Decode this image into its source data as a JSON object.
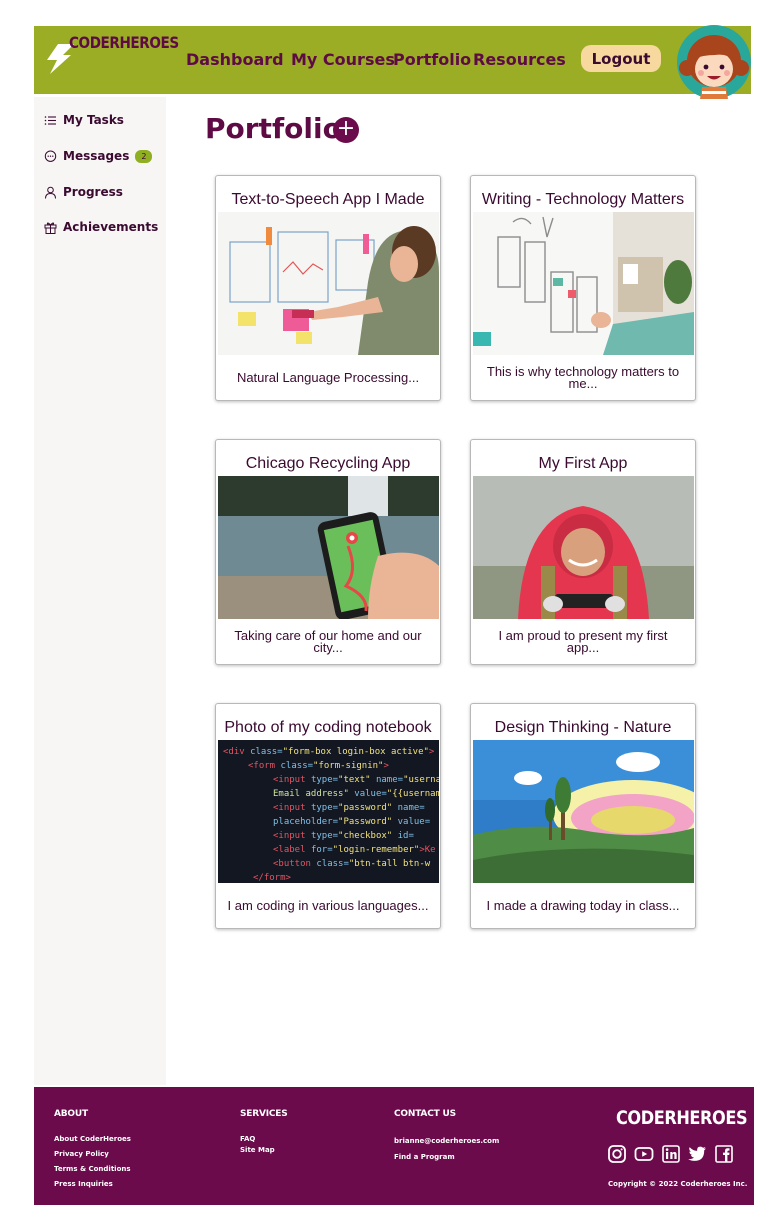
{
  "header": {
    "brand": "CODERHEROES",
    "nav": [
      "Dashboard",
      "My Courses",
      "Portfolio",
      "Resources"
    ],
    "logout_label": "Logout"
  },
  "sidebar": {
    "items": [
      {
        "label": "My Tasks",
        "icon": "list-icon"
      },
      {
        "label": "Messages",
        "icon": "chat-icon",
        "badge": "2"
      },
      {
        "label": "Progress",
        "icon": "person-icon"
      },
      {
        "label": "Achievements",
        "icon": "gift-icon"
      }
    ]
  },
  "main": {
    "title": "Portfolio",
    "add_label": "+",
    "cards": [
      {
        "title": "Text-to-Speech App I Made",
        "description": "Natural Language Processing..."
      },
      {
        "title": "Writing - Technology Matters",
        "description": "This is why technology matters to me..."
      },
      {
        "title": "Chicago Recycling App",
        "description": "Taking care of our home and our city..."
      },
      {
        "title": "My First App",
        "description": "I am proud to present my first app..."
      },
      {
        "title": "Photo of my coding notebook",
        "description": "I am coding in various languages..."
      },
      {
        "title": "Design Thinking - Nature",
        "description": "I made a drawing today in class..."
      }
    ]
  },
  "footer": {
    "about": {
      "heading": "ABOUT",
      "links": [
        "About CoderHeroes",
        "Privacy Policy",
        "Terms & Conditions",
        "Press Inquiries"
      ]
    },
    "services": {
      "heading": "SERVICES",
      "links": [
        "FAQ",
        "Site Map"
      ]
    },
    "contact": {
      "heading": "CONTACT US",
      "links": [
        "brianne@coderheroes.com",
        "Find a Program"
      ]
    },
    "brand": "CODERHEROES",
    "social": [
      "instagram-icon",
      "youtube-icon",
      "linkedin-icon",
      "twitter-icon",
      "facebook-icon"
    ],
    "copyright": "Copyright © 2022 Coderheroes Inc."
  },
  "colors": {
    "header_bg": "#9bad24",
    "brand_purple": "#5e0b45",
    "footer_bg": "#6b0b4c",
    "logout_bg": "#f7d9a0",
    "badge_bg": "#8fae22"
  }
}
